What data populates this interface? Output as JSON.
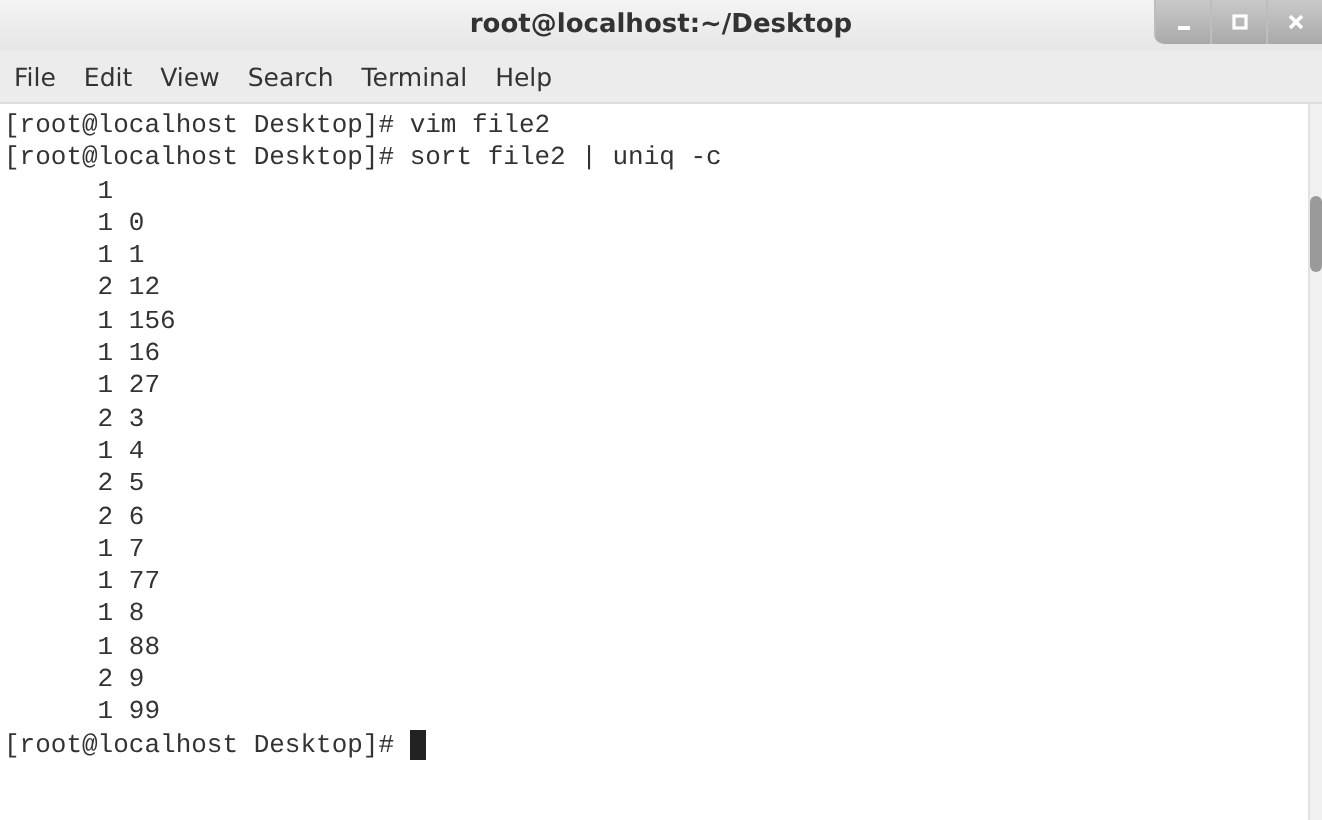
{
  "window": {
    "title": "root@localhost:~/Desktop"
  },
  "menu": [
    "File",
    "Edit",
    "View",
    "Search",
    "Terminal",
    "Help"
  ],
  "terminal": {
    "lines": [
      "[root@localhost Desktop]# vim file2",
      "[root@localhost Desktop]# sort file2 | uniq -c",
      "      1 ",
      "      1 0",
      "      1 1",
      "      2 12",
      "      1 156",
      "      1 16",
      "      1 27",
      "      2 3",
      "      1 4",
      "      2 5",
      "      2 6",
      "      1 7",
      "      1 77",
      "      1 8",
      "      1 88",
      "      2 9",
      "      1 99"
    ],
    "prompt": "[root@localhost Desktop]# "
  }
}
